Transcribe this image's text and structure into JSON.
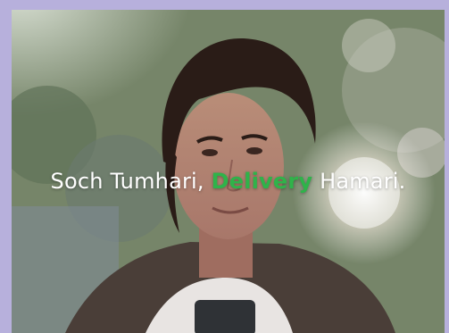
{
  "tagline": {
    "part1": "Soch Tumhari, ",
    "highlight": "Delivery",
    "part2": " Hamari."
  },
  "colors": {
    "frame": "#b7b0dc",
    "highlight": "#2fb34a",
    "text": "#ffffff"
  }
}
